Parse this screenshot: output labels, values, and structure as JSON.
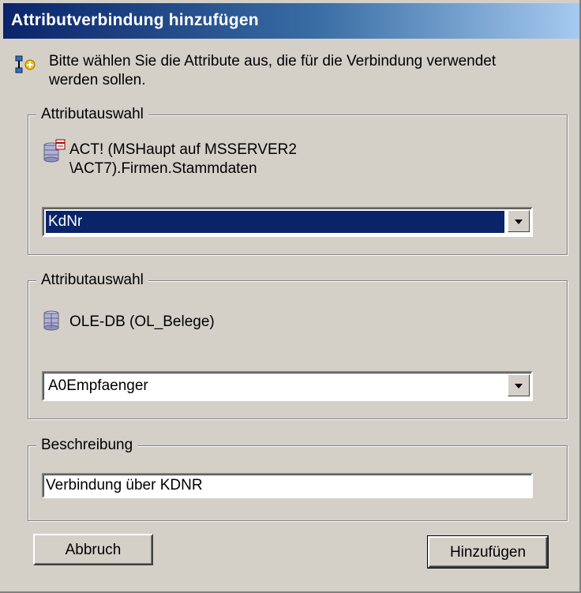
{
  "dialog": {
    "title": "Attributverbindung hinzufügen",
    "info_text": "Bitte wählen Sie die Attribute aus, die für die Verbindung verwendet werden sollen.",
    "info_icon": "link-attribute-add-icon",
    "accent_color": "#0a246a"
  },
  "group1": {
    "legend": "Attributauswahl",
    "source_icon": "database-table-icon",
    "source_line1": "ACT! (MSHaupt auf MSSERVER2",
    "source_line2": "\\ACT7).Firmen.Stammdaten",
    "selected_attribute": "KdNr"
  },
  "group2": {
    "legend": "Attributauswahl",
    "source_icon": "database-table-icon",
    "source_text": "OLE-DB (OL_Belege)",
    "selected_attribute": "A0Empfaenger"
  },
  "description": {
    "legend": "Beschreibung",
    "value": "Verbindung über KDNR"
  },
  "buttons": {
    "cancel_label": "Abbruch",
    "add_label": "Hinzufügen"
  }
}
